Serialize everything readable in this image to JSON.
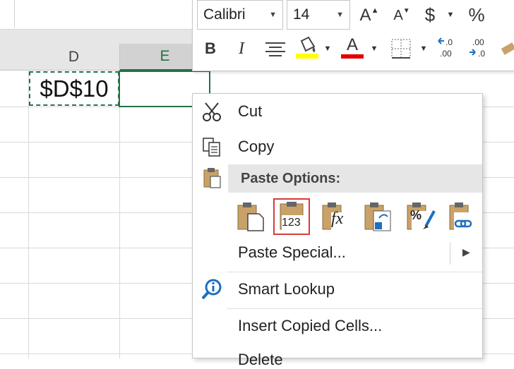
{
  "sheet": {
    "columns": [
      "D",
      "E"
    ],
    "cell_d10": "$D$10"
  },
  "mini_toolbar": {
    "font_name": "Calibri",
    "font_size": "14",
    "grow_font": "A",
    "shrink_font": "A",
    "currency": "$",
    "percent": "%",
    "bold": "B",
    "italic": "I",
    "font_color_letter": "A",
    "highlight_color": "#ffff00",
    "font_color": "#e00000"
  },
  "context_menu": {
    "cut": "Cut",
    "copy": "Copy",
    "paste_options": "Paste Options:",
    "paste_special": "Paste Special...",
    "smart_lookup": "Smart Lookup",
    "insert_copied_cells": "Insert Copied Cells...",
    "delete": "Delete",
    "paste_value_icon_text": "123",
    "formula_icon_text": "fx",
    "formatting_icon_text": "%"
  },
  "colors": {
    "excel_green": "#217346",
    "selected_border": "#d83b3b",
    "clipboard_tan": "#c9a26a"
  }
}
